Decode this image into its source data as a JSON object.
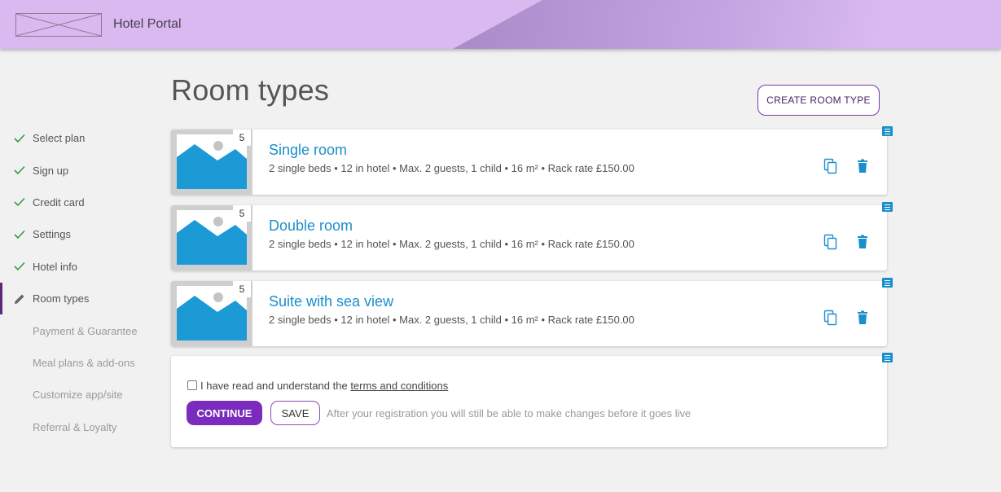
{
  "header": {
    "app_title": "Hotel Portal",
    "logo": "placeholder-logo"
  },
  "sidebar": {
    "items": [
      {
        "label": "Select plan",
        "state": "done",
        "icon": "check-icon"
      },
      {
        "label": "Sign up",
        "state": "done",
        "icon": "check-icon"
      },
      {
        "label": "Credit card",
        "state": "done",
        "icon": "check-icon"
      },
      {
        "label": "Settings",
        "state": "done",
        "icon": "check-icon"
      },
      {
        "label": "Hotel info",
        "state": "done",
        "icon": "check-icon"
      },
      {
        "label": "Room types",
        "state": "active",
        "icon": "pencil-icon"
      },
      {
        "label": "Payment & Guarantee",
        "state": "pending",
        "icon": ""
      },
      {
        "label": "Meal plans & add-ons",
        "state": "pending",
        "icon": ""
      },
      {
        "label": "Customize app/site",
        "state": "pending",
        "icon": ""
      },
      {
        "label": "Referral & Loyalty",
        "state": "pending",
        "icon": ""
      }
    ]
  },
  "main": {
    "title": "Room types",
    "create_button": "CREATE ROOM TYPE",
    "rooms": [
      {
        "name": "Single room",
        "description": "2 single beds • 12 in hotel • Max. 2 guests, 1 child • 16 m² • Rack rate £150.00",
        "photo_count": "5"
      },
      {
        "name": "Double room",
        "description": "2 single beds • 12 in hotel • Max. 2 guests, 1 child • 16 m² • Rack rate £150.00",
        "photo_count": "5"
      },
      {
        "name": "Suite with sea view",
        "description": "2 single beds • 12 in hotel • Max. 2 guests, 1 child • 16 m² • Rack rate £150.00",
        "photo_count": "5"
      }
    ],
    "terms": {
      "prefix": "I have read and understand the ",
      "link": "terms and conditions",
      "continue_button": "CONTINUE",
      "save_button": "SAVE",
      "hint": "After your registration you will still be able to make changes before it goes live"
    }
  },
  "colors": {
    "header": "#d9b9ef",
    "accent_purple": "#7b2cbf",
    "link_blue": "#1b8fcc",
    "check_green": "#2e9e3e"
  }
}
